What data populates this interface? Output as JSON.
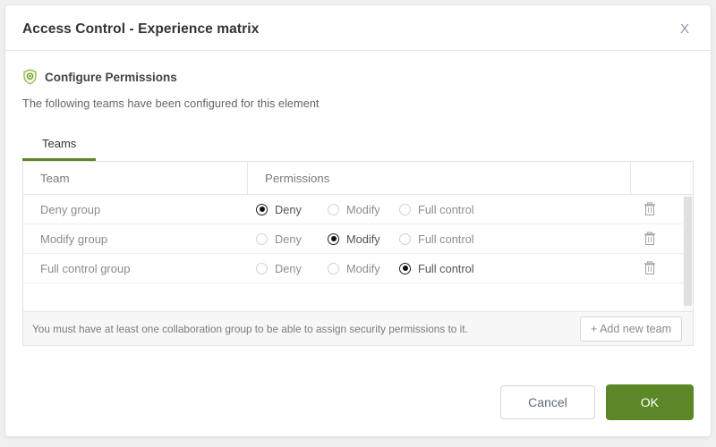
{
  "dialog": {
    "title": "Access Control - Experience matrix",
    "close_label": "X",
    "close_icon": "close-icon"
  },
  "section": {
    "icon": "shield-icon",
    "heading": "Configure Permissions",
    "subheading": "The following teams have been configured for this element"
  },
  "tabs": [
    {
      "label": "Teams",
      "active": true
    }
  ],
  "table": {
    "columns": [
      "Team",
      "Permissions",
      ""
    ],
    "permission_options": [
      "Deny",
      "Modify",
      "Full control"
    ],
    "row_action_icon": "trash-icon",
    "rows": [
      {
        "team": "Deny group",
        "permission": "Deny"
      },
      {
        "team": "Modify group",
        "permission": "Modify"
      },
      {
        "team": "Full control group",
        "permission": "Full control"
      }
    ],
    "footer_note": "You must have at least one collaboration group to be able to assign security permissions to it.",
    "add_button": "+ Add new team"
  },
  "footer": {
    "cancel_label": "Cancel",
    "ok_label": "OK"
  },
  "colors": {
    "accent_green": "#5c8727",
    "tab_underline": "#5c8727",
    "shield_green": "#8cb63c",
    "text_primary": "#333333",
    "text_muted": "#8b8b8b",
    "border": "#e3e3e3"
  }
}
